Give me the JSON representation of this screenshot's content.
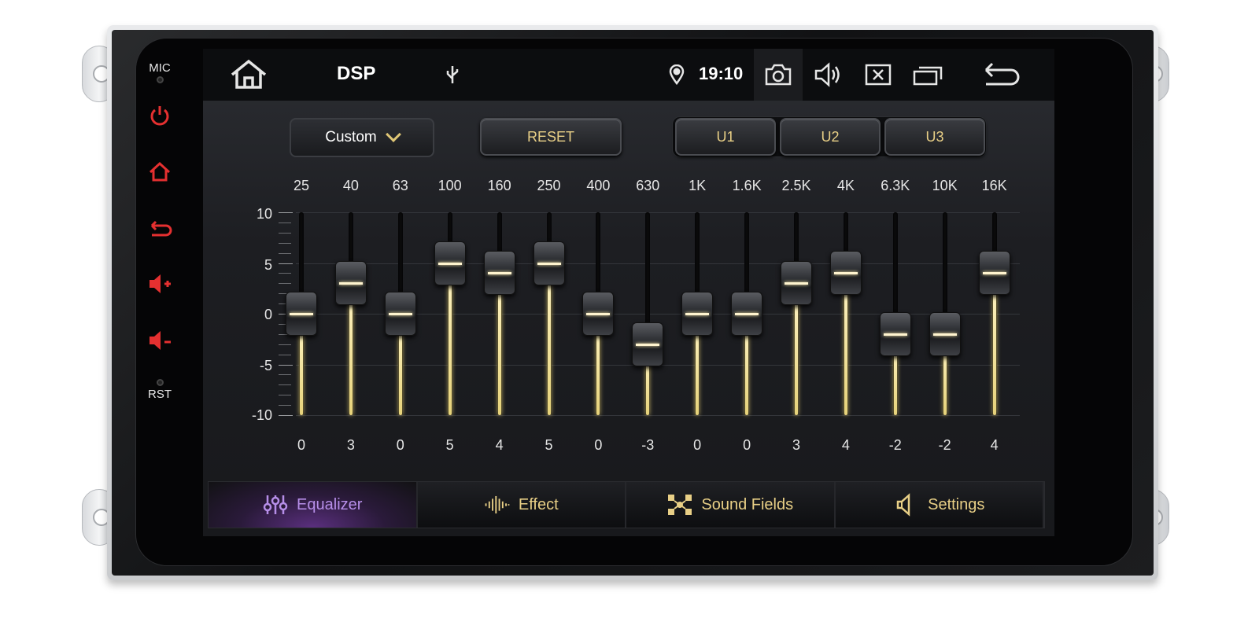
{
  "device": {
    "side_labels": {
      "mic": "MIC",
      "rst": "RST"
    },
    "side_icons": [
      "power-icon",
      "home-icon",
      "back-icon",
      "volume-up-icon",
      "volume-down-icon"
    ],
    "side_icon_color": "#e53030"
  },
  "statusbar": {
    "title": "DSP",
    "time": "19:10",
    "icons": [
      "home-icon",
      "usb-icon",
      "location-icon",
      "camera-icon",
      "volume-icon",
      "close-window-icon",
      "recent-apps-icon",
      "back-arrow-icon"
    ]
  },
  "controls": {
    "preset": "Custom",
    "reset": "RESET",
    "user_presets": [
      "U1",
      "U2",
      "U3"
    ]
  },
  "equalizer": {
    "y_ticks": [
      "10",
      "5",
      "0",
      "-5",
      "-10"
    ],
    "ylim": [
      -10,
      10
    ],
    "bands": [
      {
        "freq": "25",
        "gain": 0
      },
      {
        "freq": "40",
        "gain": 3
      },
      {
        "freq": "63",
        "gain": 0
      },
      {
        "freq": "100",
        "gain": 5
      },
      {
        "freq": "160",
        "gain": 4
      },
      {
        "freq": "250",
        "gain": 5
      },
      {
        "freq": "400",
        "gain": 0
      },
      {
        "freq": "630",
        "gain": -3
      },
      {
        "freq": "1K",
        "gain": 0
      },
      {
        "freq": "1.6K",
        "gain": 0
      },
      {
        "freq": "2.5K",
        "gain": 3
      },
      {
        "freq": "4K",
        "gain": 4
      },
      {
        "freq": "6.3K",
        "gain": -2
      },
      {
        "freq": "10K",
        "gain": -2
      },
      {
        "freq": "16K",
        "gain": 4
      }
    ],
    "accent": "#e8cf86"
  },
  "tabs": [
    {
      "label": "Equalizer",
      "icon": "equalizer-sliders-icon",
      "active": true
    },
    {
      "label": "Effect",
      "icon": "waveform-icon",
      "active": false
    },
    {
      "label": "Sound Fields",
      "icon": "sound-fields-icon",
      "active": false
    },
    {
      "label": "Settings",
      "icon": "speaker-icon",
      "active": false
    }
  ]
}
